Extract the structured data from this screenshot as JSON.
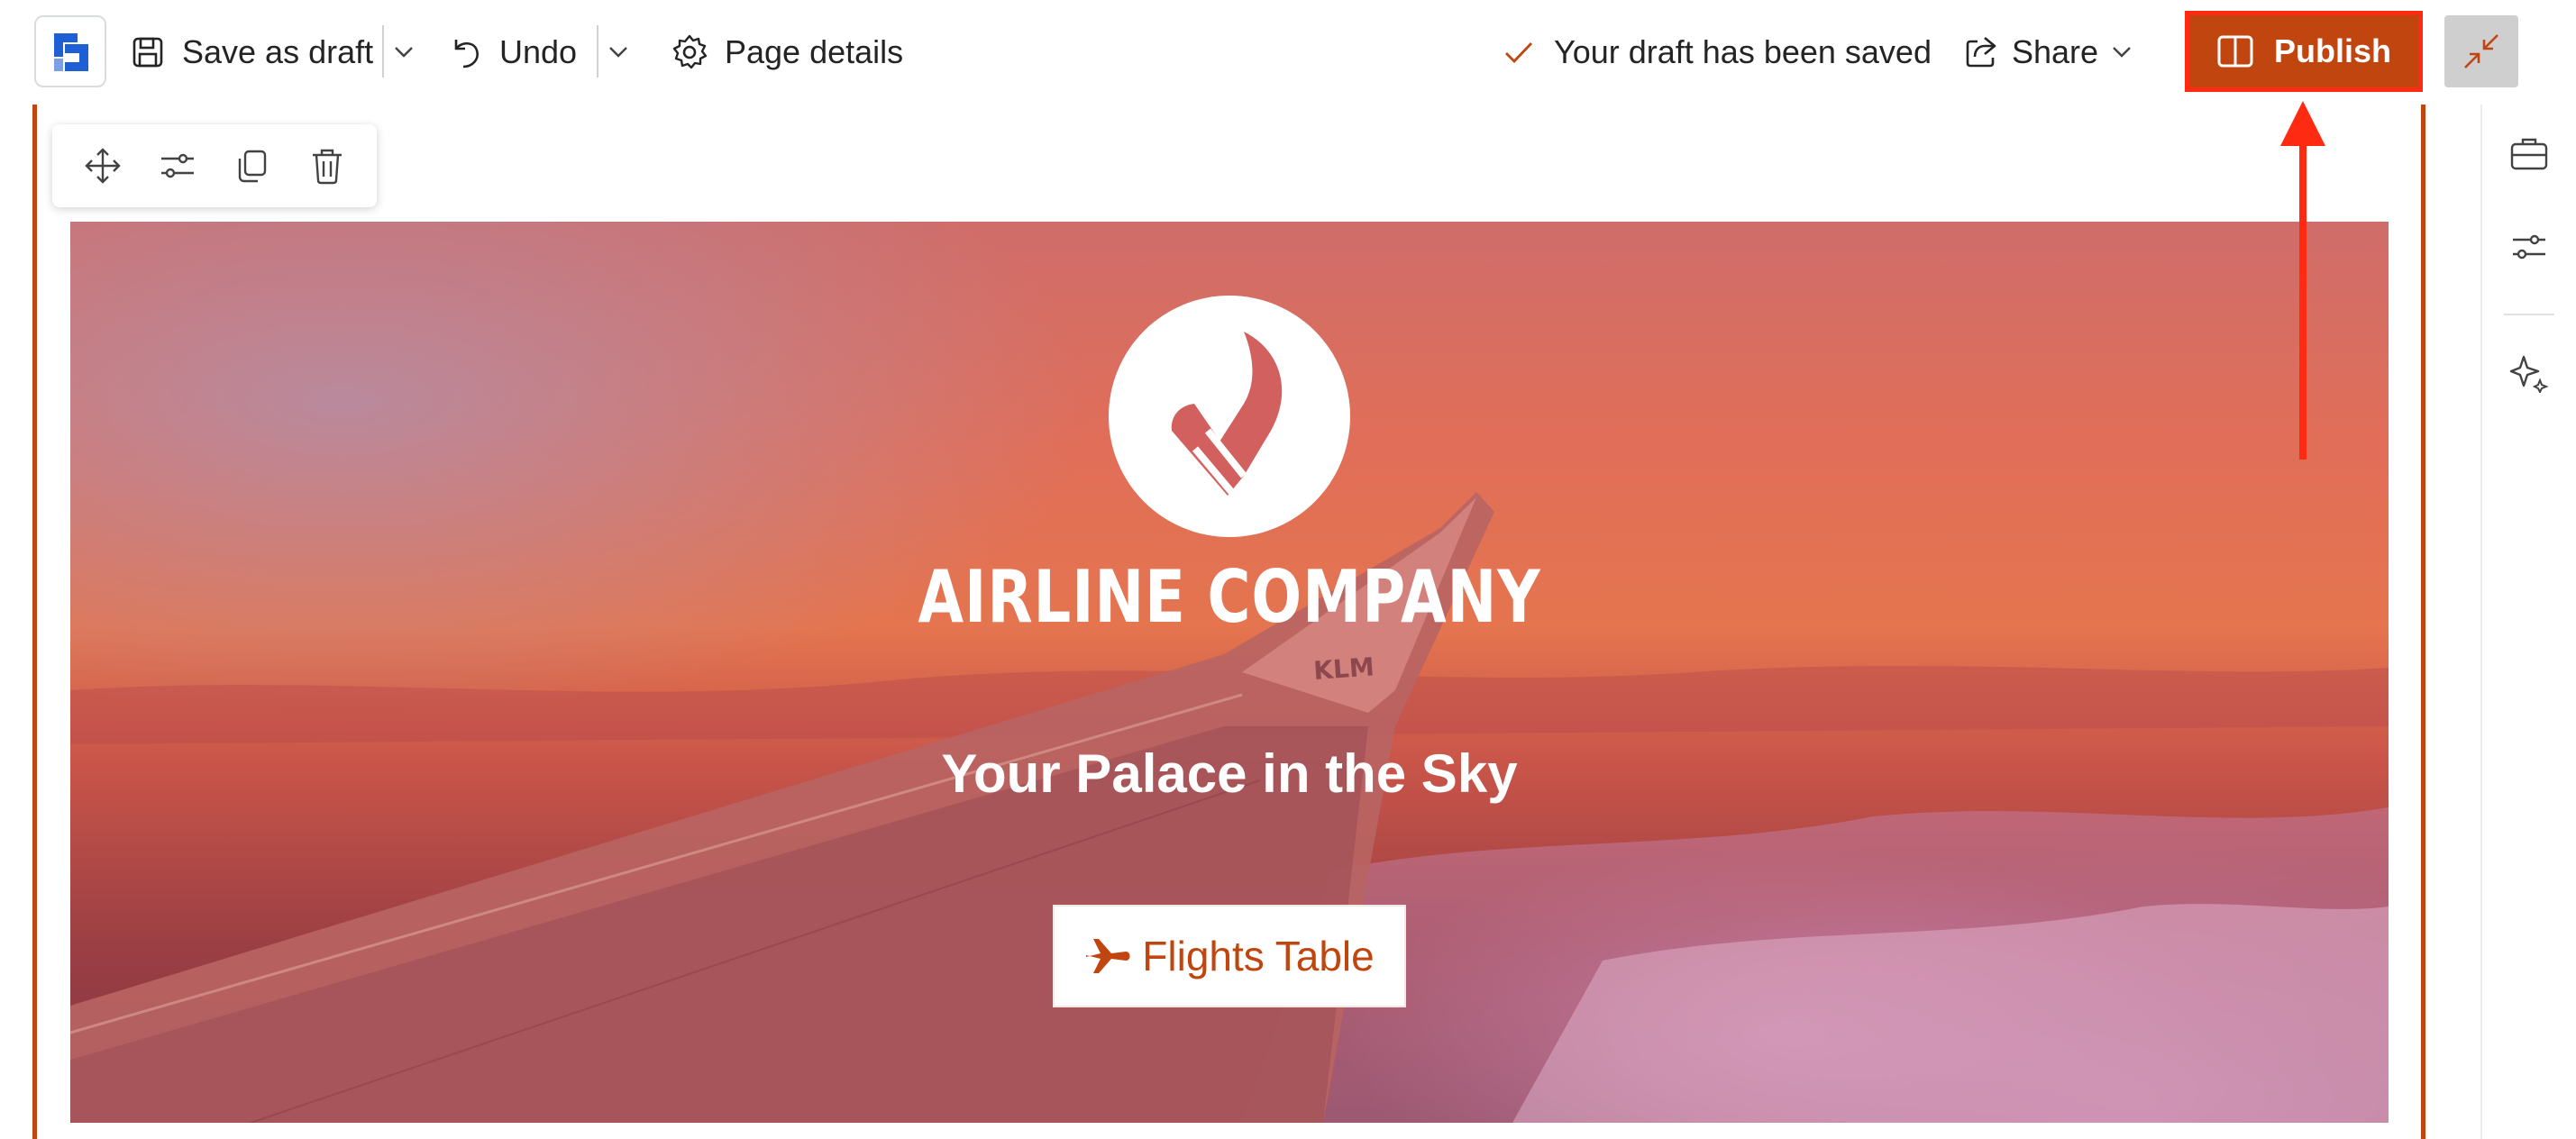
{
  "toolbar": {
    "save_draft_label": "Save as draft",
    "undo_label": "Undo",
    "page_details_label": "Page details",
    "status_text": "Your draft has been saved",
    "share_label": "Share",
    "publish_label": "Publish"
  },
  "section_toolbar": {
    "tools": [
      "move-icon",
      "settings-sliders-icon",
      "copy-icon",
      "delete-icon"
    ]
  },
  "hero": {
    "company_name": "AIRLINE COMPANY",
    "tagline": "Your Palace in the Sky",
    "button_label": "Flights Table",
    "button_icon": "airplane-icon",
    "wing_text": "KLM"
  },
  "right_rail": {
    "icons": [
      "briefcase-icon",
      "settings-sliders-icon",
      "sparkle-icon"
    ]
  },
  "colors": {
    "accent": "#c0450f",
    "highlight_border": "#ff2a12",
    "annotation_arrow": "#ff2a12"
  }
}
